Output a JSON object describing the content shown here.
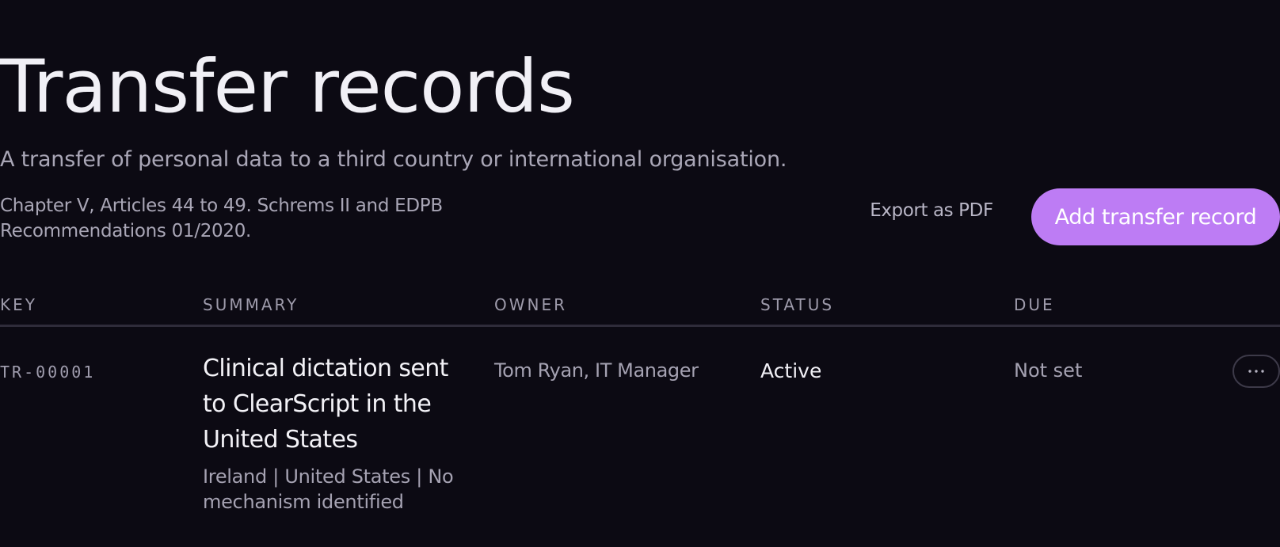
{
  "page": {
    "title": "Transfer records",
    "subtitle": "A transfer of personal data to a third country or international organisation.",
    "reference": "Chapter V, Articles 44 to 49. Schrems II and EDPB Recommendations 01/2020."
  },
  "actions": {
    "export_label": "Export as PDF",
    "add_label": "Add transfer record"
  },
  "colors": {
    "background": "#0c0a13",
    "accent": "#bd7cf4"
  },
  "table": {
    "columns": {
      "key": "KEY",
      "summary": "SUMMARY",
      "owner": "OWNER",
      "status": "STATUS",
      "due": "DUE"
    },
    "rows": [
      {
        "key": "TR-00001",
        "summary_title": "Clinical dictation sent to ClearScript in the United States",
        "summary_meta": "Ireland | United States | No mechanism identified",
        "owner": "Tom Ryan, IT Manager",
        "status": "Active",
        "due": "Not set",
        "actions_icon": "more-horizontal-icon"
      }
    ]
  }
}
